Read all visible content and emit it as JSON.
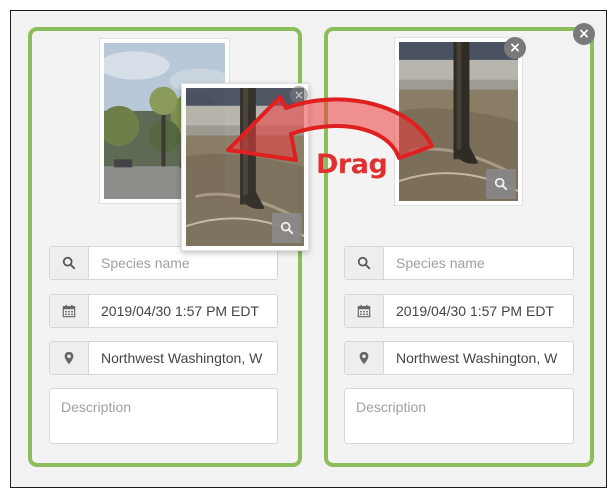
{
  "annotation": {
    "drag_label": "Drag"
  },
  "cards": [
    {
      "species": {
        "placeholder": "Species name"
      },
      "datetime": {
        "value": "2019/04/30 1:57 PM EDT"
      },
      "location": {
        "value": "Northwest Washington, W"
      },
      "description": {
        "placeholder": "Description"
      }
    },
    {
      "species": {
        "placeholder": "Species name"
      },
      "datetime": {
        "value": "2019/04/30 1:57 PM EDT"
      },
      "location": {
        "value": "Northwest Washington, W"
      },
      "description": {
        "placeholder": "Description"
      }
    }
  ],
  "icons": {
    "close": "×",
    "species": "search-icon",
    "datetime": "calendar-icon",
    "location": "map-marker-icon",
    "zoom": "search-icon"
  },
  "colors": {
    "card_border": "#8dbd5b",
    "arrow": "#e02020",
    "close_bg": "#7a7a7a"
  }
}
